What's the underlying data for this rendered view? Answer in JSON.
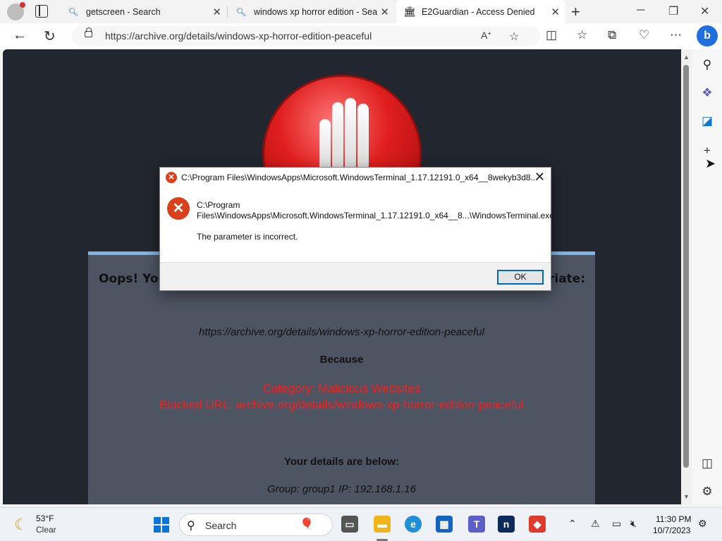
{
  "browser": {
    "tabs": [
      {
        "label": "getscreen - Search",
        "icon": "search-icon"
      },
      {
        "label": "windows xp horror edition - Sea",
        "icon": "search-icon"
      },
      {
        "label": "E2Guardian - Access Denied",
        "icon": "archive-icon",
        "active": true
      }
    ],
    "url": "https://archive.org/details/windows-xp-horror-edition-peaceful"
  },
  "page": {
    "heading_left": "Oops! You",
    "heading_right": "riate:",
    "blocked_url": "https://archive.org/details/windows-xp-horror-edition-peaceful",
    "because": "Because",
    "category": "Category: Malicious Websites",
    "blocked_line": "Blocked URL: archive.org/details/windows-xp-horror-edition-peaceful",
    "details_heading": "Your details are below:",
    "details": "Group: group1   IP: 192.168.1.16",
    "accent_color": "#ff1a1a"
  },
  "dialog": {
    "title": "C:\\Program Files\\WindowsApps\\Microsoft.WindowsTerminal_1.17.12191.0_x64__8wekyb3d8...",
    "message_line1": "C:\\Program",
    "message_line2": "Files\\WindowsApps\\Microsoft.WindowsTerminal_1.17.12191.0_x64__8...\\WindowsTerminal.exe",
    "message_detail": "The parameter is incorrect.",
    "ok_label": "OK"
  },
  "taskbar": {
    "weather_temp": "53°F",
    "weather_cond": "Clear",
    "search_label": "Search",
    "time": "11:30 PM",
    "date": "10/7/2023"
  }
}
